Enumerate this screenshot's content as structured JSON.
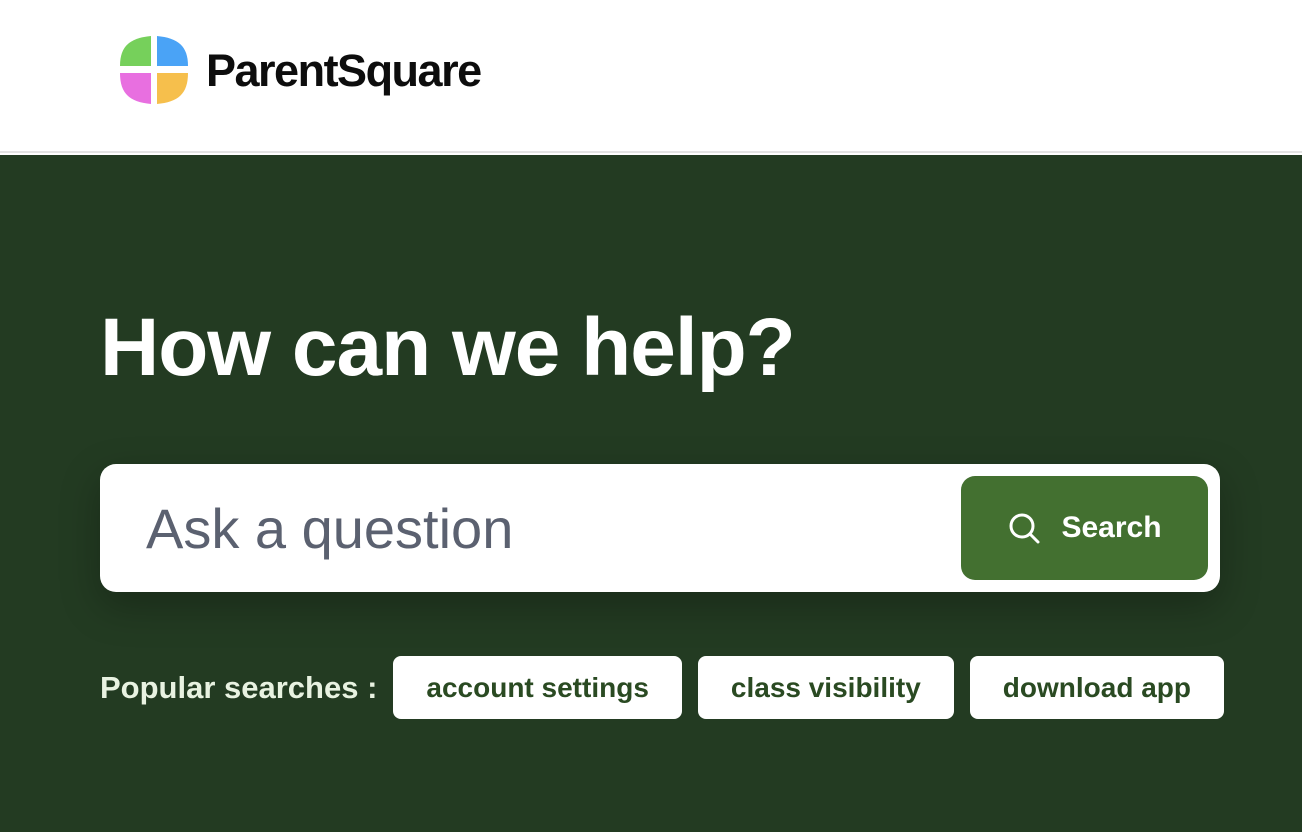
{
  "header": {
    "brand_name": "ParentSquare",
    "logo_icon": "parentsquare-logo-icon",
    "logo_colors": [
      "#76d05b",
      "#4aa3f6",
      "#e86fe0",
      "#f6bf4c"
    ]
  },
  "hero": {
    "background_color": "#233b22",
    "title": "How can we help?",
    "search": {
      "placeholder": "Ask a question",
      "value": "",
      "button_label": "Search",
      "button_icon": "search-icon",
      "button_color": "#437030"
    },
    "popular_searches": {
      "label": "Popular searches :",
      "items": [
        {
          "label": "account settings"
        },
        {
          "label": "class visibility"
        },
        {
          "label": "download app"
        }
      ]
    }
  }
}
